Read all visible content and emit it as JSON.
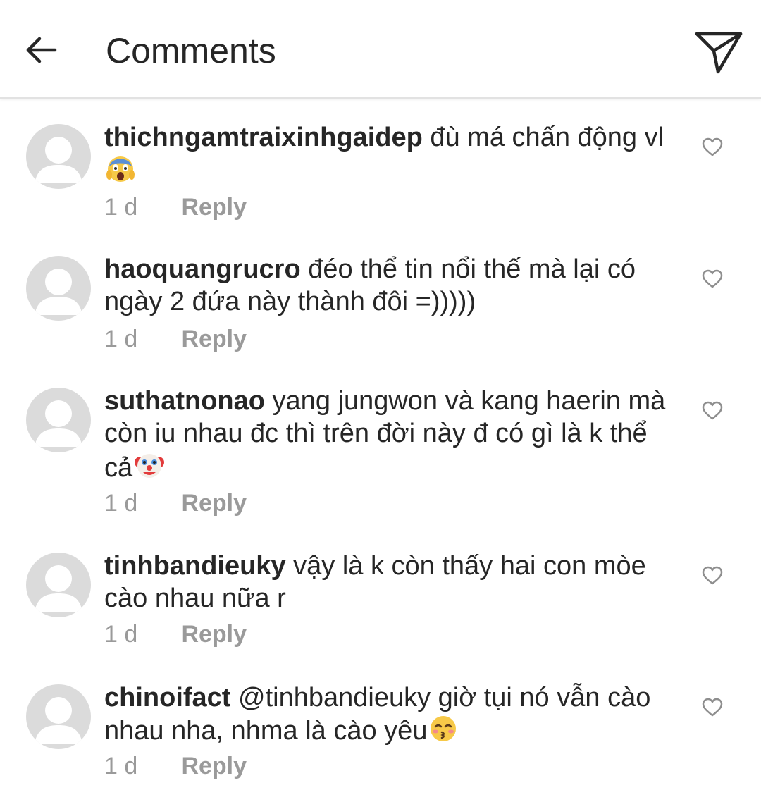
{
  "header": {
    "title": "Comments",
    "back_icon": "back-arrow-icon",
    "share_icon": "direct-send-icon"
  },
  "comments": [
    {
      "username": "thichngamtraixinhgaidep",
      "text": "đù má chấn động vl",
      "emoji": "screaming-face-emoji",
      "time": "1 d",
      "reply": "Reply"
    },
    {
      "username": "haoquangrucro",
      "text": "đéo thể tin nổi thế mà lại có ngày 2 đứa này thành đôi =)))))",
      "time": "1 d",
      "reply": "Reply"
    },
    {
      "username": "suthatnonao",
      "text": "yang jungwon và kang haerin mà còn iu nhau đc thì trên đời này đ có gì là k thể cả",
      "emoji": "clown-face-emoji",
      "time": "1 d",
      "reply": "Reply"
    },
    {
      "username": "tinhbandieuky",
      "text": "vậy là k còn thấy hai con mòe cào nhau nữa r",
      "time": "1 d",
      "reply": "Reply"
    },
    {
      "username": "chinoifact",
      "text": "@tinhbandieuky giờ tụi nó vẫn cào nhau nha, nhma là cào yêu",
      "emoji": "kissing-face-emoji",
      "time": "1 d",
      "reply": "Reply"
    }
  ],
  "colors": {
    "text": "#262626",
    "secondary": "#999999",
    "avatar": "#dbdbdb",
    "divider": "#e2e2e2"
  }
}
